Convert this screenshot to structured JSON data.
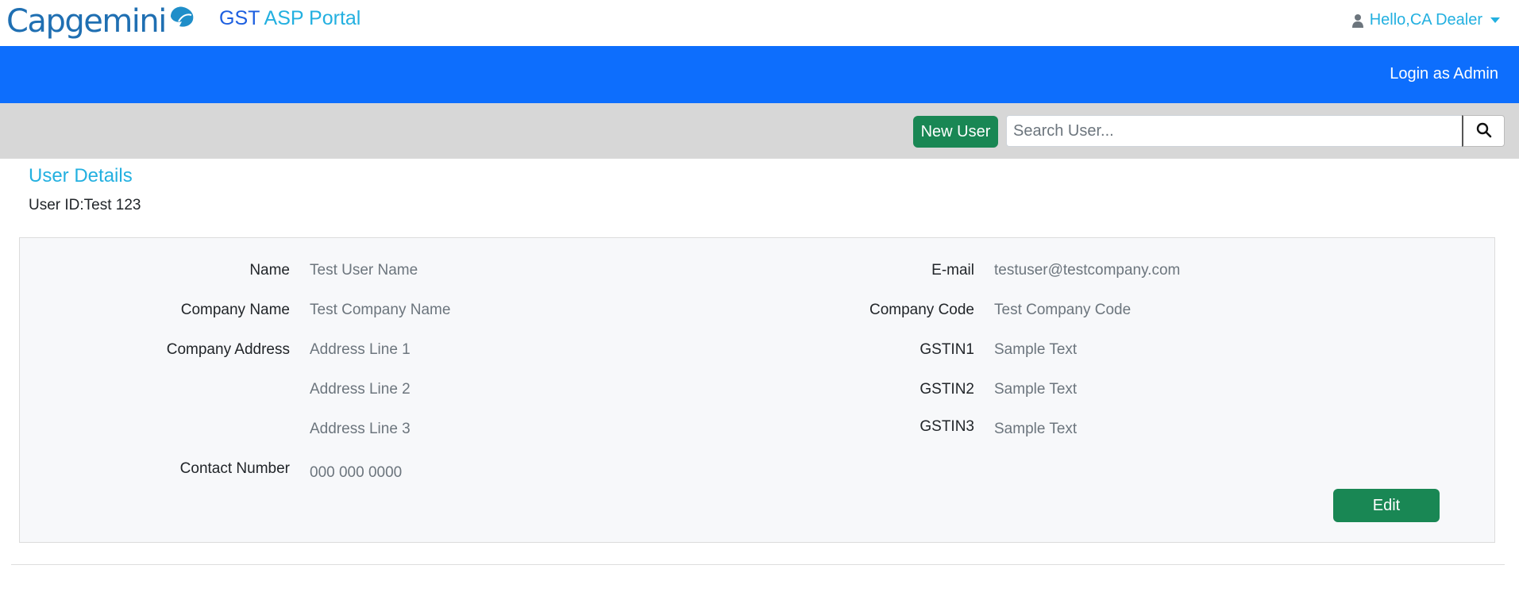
{
  "brand": {
    "logo_text": "Capgemini",
    "title_gst": "GST",
    "title_rest": "ASP Portal"
  },
  "header": {
    "user_greeting": "Hello,CA Dealer"
  },
  "nav": {
    "login_as_admin": "Login as Admin"
  },
  "toolbar": {
    "new_user_label": "New User",
    "search_placeholder": "Search User..."
  },
  "page": {
    "title": "User Details",
    "user_id": "User ID:Test 123"
  },
  "details": {
    "name_label": "Name",
    "name_value": "Test User Name",
    "company_name_label": "Company Name",
    "company_name_value": "Test Company Name",
    "company_address_label": "Company Address",
    "address_line1": "Address Line 1",
    "address_line2": "Address Line 2",
    "address_line3": "Address Line 3",
    "contact_label": "Contact Number",
    "contact_value": "000 000 0000",
    "email_label": "E-mail",
    "email_value": "testuser@testcompany.com",
    "company_code_label": "Company Code",
    "company_code_value": "Test Company Code",
    "gstin1_label": "GSTIN1",
    "gstin1_value": "Sample Text",
    "gstin2_label": "GSTIN2",
    "gstin2_value": "Sample Text",
    "gstin3_label": "GSTIN3",
    "gstin3_value": "Sample Text",
    "edit_label": "Edit"
  },
  "colors": {
    "primary": "#0d6efd",
    "success": "#198754",
    "accent": "#23b0e0",
    "toolbar_bg": "#d7d7d7"
  },
  "icons": {
    "user": "user-icon",
    "caret": "caret-down-icon",
    "search": "search-icon",
    "logo_mark": "spade-icon"
  }
}
